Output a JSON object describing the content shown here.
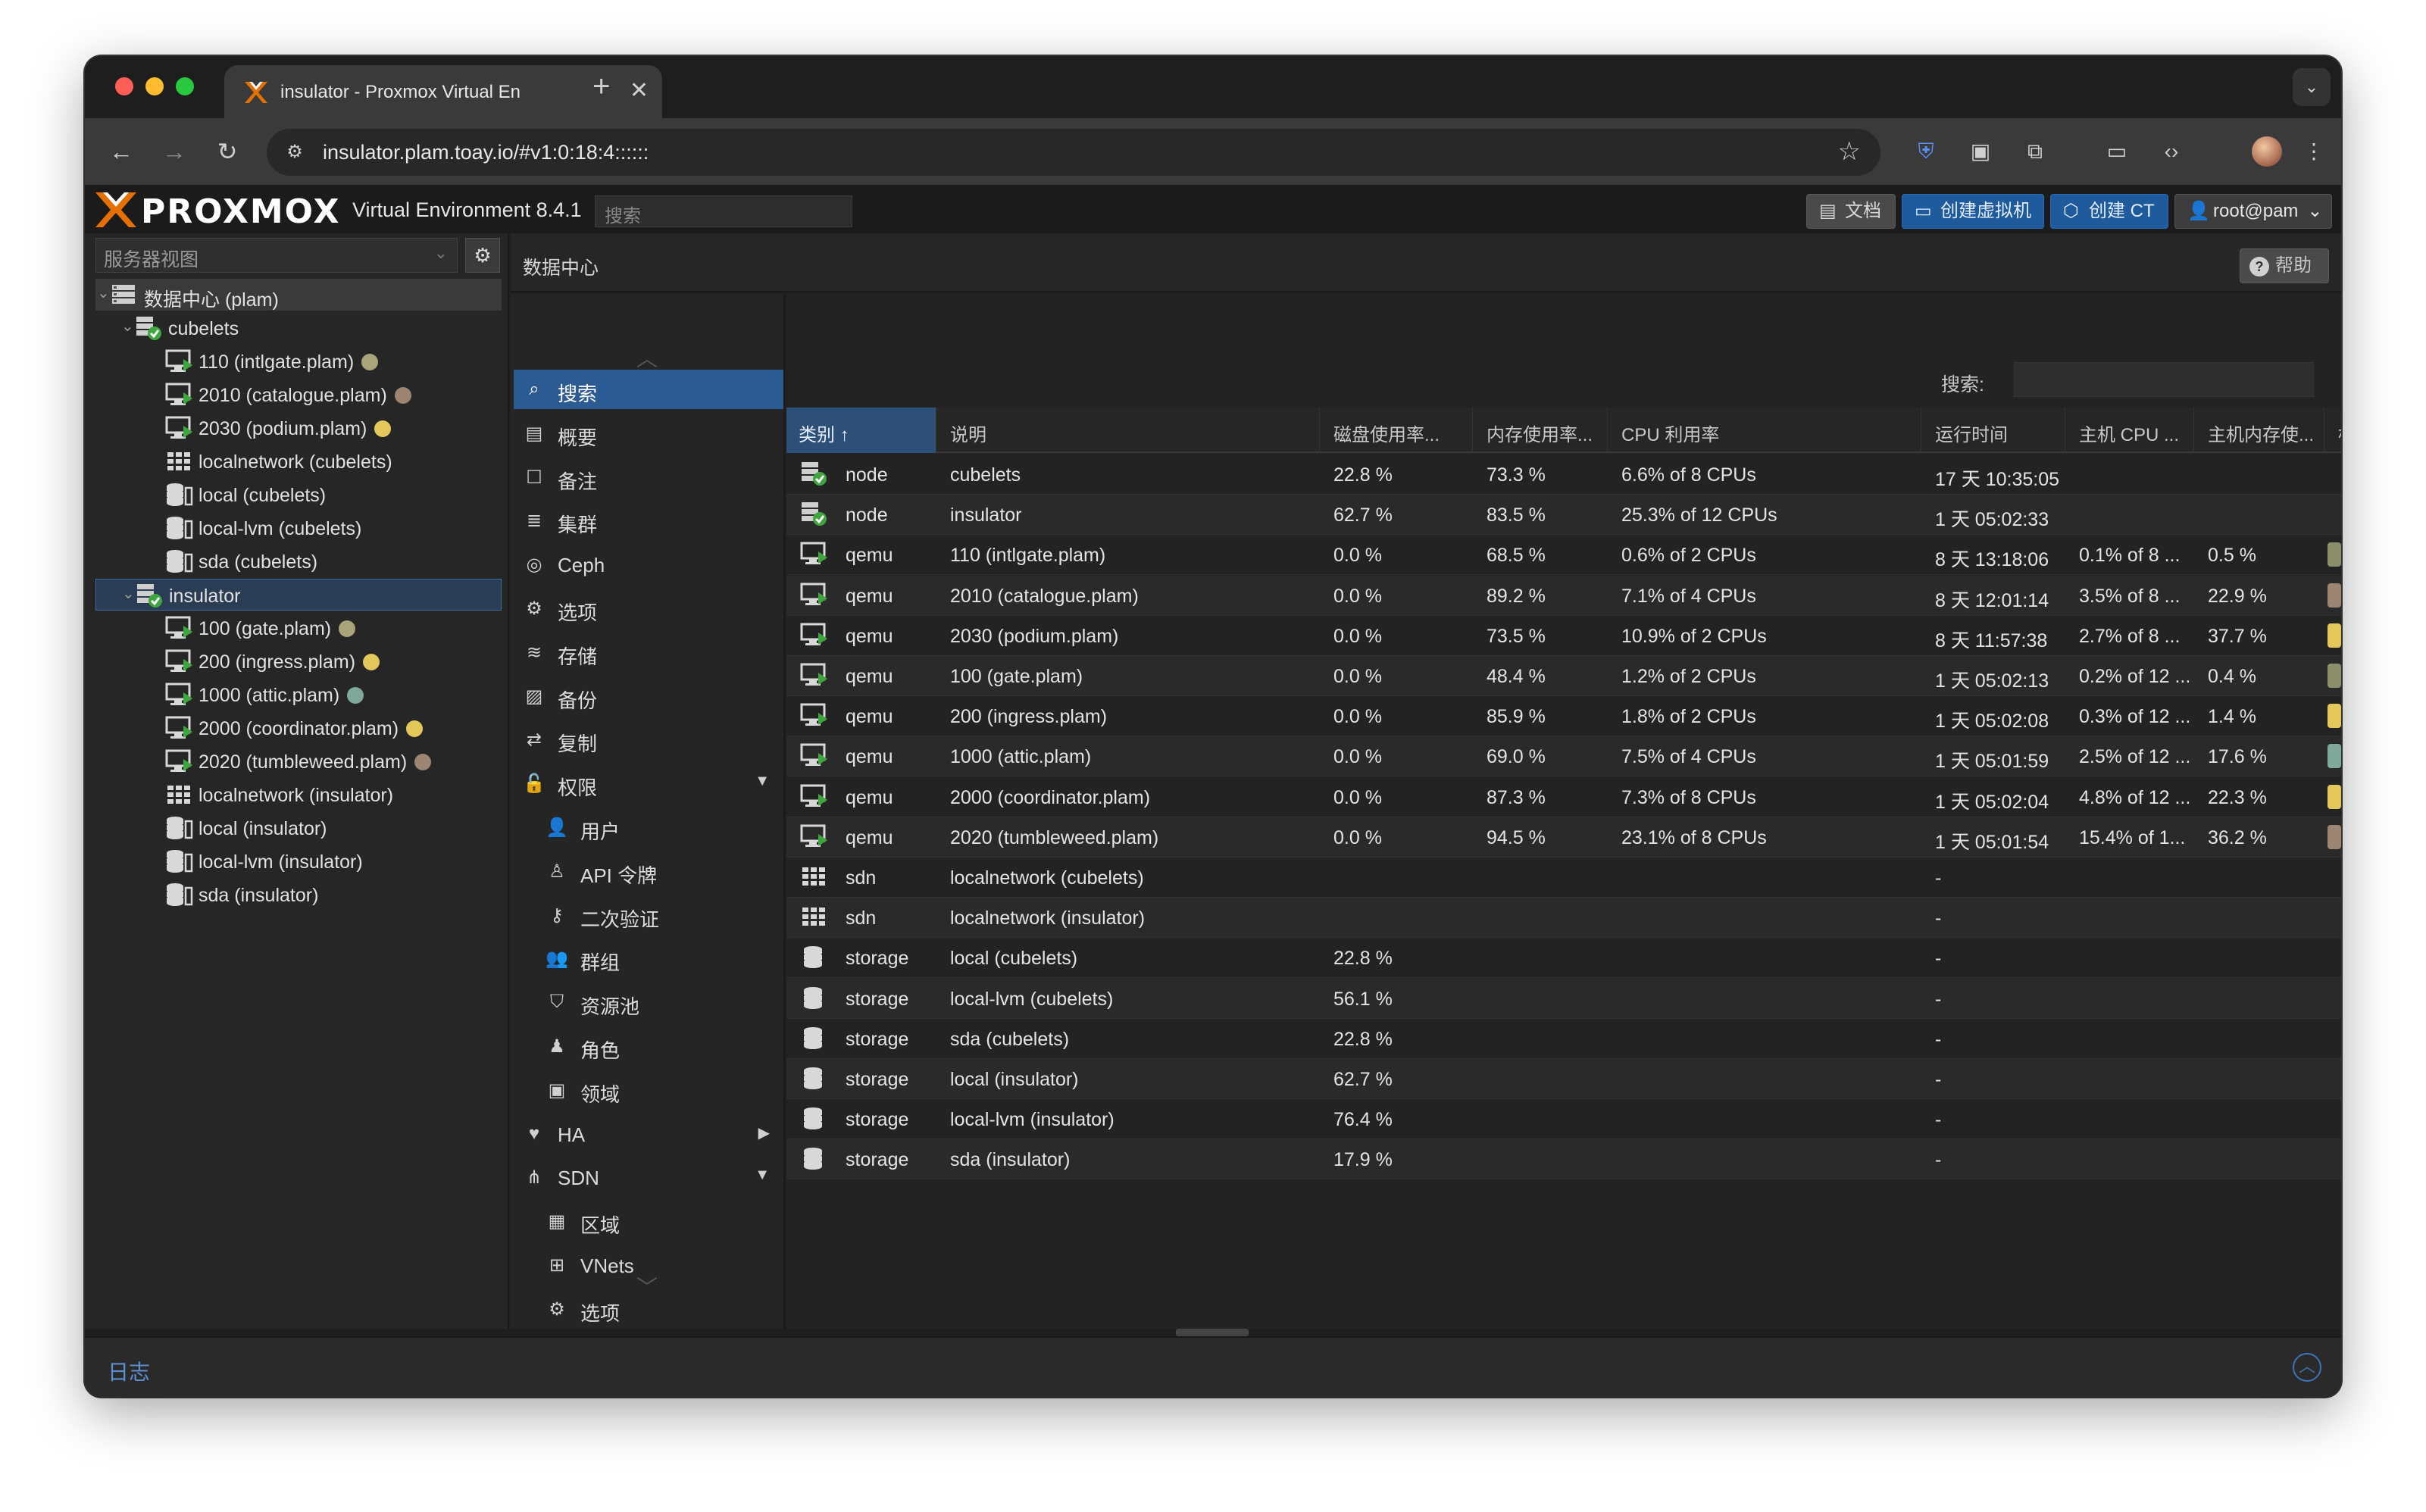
{
  "browser": {
    "tab_title": "insulator - Proxmox Virtual En",
    "url": "insulator.plam.toay.io/#v1:0:18:4::::::"
  },
  "header": {
    "logo": "PROXMOX",
    "version": "Virtual Environment 8.4.1",
    "search_placeholder": "搜索",
    "btn_docs": "文档",
    "btn_create_vm": "创建虚拟机",
    "btn_create_ct": "创建 CT",
    "btn_user": "root@pam"
  },
  "left": {
    "view_select": "服务器视图",
    "tree": [
      {
        "label": "数据中心 (plam)",
        "icon": "datacenter-icon",
        "level": 0
      },
      {
        "label": "cubelets",
        "icon": "node-icon",
        "level": 1
      },
      {
        "label": "110 (intlgate.plam)",
        "icon": "vm-icon",
        "level": 2,
        "dot": "#a9a47a"
      },
      {
        "label": "2010 (catalogue.plam)",
        "icon": "vm-icon",
        "level": 2,
        "dot": "#9c8573"
      },
      {
        "label": "2030 (podium.plam)",
        "icon": "vm-icon",
        "level": 2,
        "dot": "#e4c75a"
      },
      {
        "label": "localnetwork (cubelets)",
        "icon": "grid-icon",
        "level": 2
      },
      {
        "label": "local (cubelets)",
        "icon": "storage-icon",
        "level": 2
      },
      {
        "label": "local-lvm (cubelets)",
        "icon": "storage-icon",
        "level": 2
      },
      {
        "label": "sda (cubelets)",
        "icon": "storage-icon",
        "level": 2
      },
      {
        "label": "insulator",
        "icon": "node-icon",
        "level": 1
      },
      {
        "label": "100 (gate.plam)",
        "icon": "vm-icon",
        "level": 2,
        "dot": "#a9a47a"
      },
      {
        "label": "200 (ingress.plam)",
        "icon": "vm-icon",
        "level": 2,
        "dot": "#e4c75a"
      },
      {
        "label": "1000 (attic.plam)",
        "icon": "vm-icon",
        "level": 2,
        "dot": "#7fa89a"
      },
      {
        "label": "2000 (coordinator.plam)",
        "icon": "vm-icon",
        "level": 2,
        "dot": "#e4c75a"
      },
      {
        "label": "2020 (tumbleweed.plam)",
        "icon": "vm-icon",
        "level": 2,
        "dot": "#9c8573"
      },
      {
        "label": "localnetwork (insulator)",
        "icon": "grid-icon",
        "level": 2
      },
      {
        "label": "local (insulator)",
        "icon": "storage-icon",
        "level": 2
      },
      {
        "label": "local-lvm (insulator)",
        "icon": "storage-icon",
        "level": 2
      },
      {
        "label": "sda (insulator)",
        "icon": "storage-icon",
        "level": 2
      }
    ]
  },
  "content": {
    "title": "数据中心",
    "help": "帮助"
  },
  "menu": [
    {
      "label": "搜索",
      "icon": "search-icon",
      "active": true,
      "level": 0
    },
    {
      "label": "概要",
      "icon": "book-icon",
      "level": 0
    },
    {
      "label": "备注",
      "icon": "note-icon",
      "level": 0
    },
    {
      "label": "集群",
      "icon": "server-icon",
      "level": 0
    },
    {
      "label": "Ceph",
      "icon": "ceph-icon",
      "level": 0
    },
    {
      "label": "选项",
      "icon": "gear-icon",
      "level": 0
    },
    {
      "label": "存储",
      "icon": "database-icon",
      "level": 0
    },
    {
      "label": "备份",
      "icon": "floppy-icon",
      "level": 0
    },
    {
      "label": "复制",
      "icon": "retweet-icon",
      "level": 0
    },
    {
      "label": "权限",
      "icon": "unlock-icon",
      "level": 0,
      "caret": "▼"
    },
    {
      "label": "用户",
      "icon": "user-icon",
      "level": 1
    },
    {
      "label": "API 令牌",
      "icon": "user-outline-icon",
      "level": 1
    },
    {
      "label": "二次验证",
      "icon": "key-icon",
      "level": 1
    },
    {
      "label": "群组",
      "icon": "users-icon",
      "level": 1
    },
    {
      "label": "资源池",
      "icon": "tags-icon",
      "level": 1
    },
    {
      "label": "角色",
      "icon": "male-icon",
      "level": 1
    },
    {
      "label": "领域",
      "icon": "address-book-icon",
      "level": 1
    },
    {
      "label": "HA",
      "icon": "heartbeat-icon",
      "level": 0,
      "caret": "▶"
    },
    {
      "label": "SDN",
      "icon": "sdn-icon",
      "level": 0,
      "caret": "▼"
    },
    {
      "label": "区域",
      "icon": "grid-icon",
      "level": 1
    },
    {
      "label": "VNets",
      "icon": "sitemap-icon",
      "level": 1
    },
    {
      "label": "选项",
      "icon": "gear-icon",
      "level": 1
    }
  ],
  "grid": {
    "search_label": "搜索:",
    "columns": [
      "类别 ↑",
      "说明",
      "磁盘使用率...",
      "内存使用率...",
      "CPU 利用率",
      "运行时间",
      "主机 CPU ...",
      "主机内存使...",
      "标"
    ],
    "rows": [
      {
        "type": "node",
        "desc": "cubelets",
        "disk": "22.8 %",
        "mem": "73.3 %",
        "cpu": "6.6% of 8 CPUs",
        "uptime": "17 天 10:35:05",
        "hcpu": "",
        "hmem": "",
        "tag": ""
      },
      {
        "type": "node",
        "desc": "insulator",
        "disk": "62.7 %",
        "mem": "83.5 %",
        "cpu": "25.3% of 12 CPUs",
        "uptime": "1 天 05:02:33",
        "hcpu": "",
        "hmem": "",
        "tag": ""
      },
      {
        "type": "qemu",
        "desc": "110 (intlgate.plam)",
        "disk": "0.0 %",
        "mem": "68.5 %",
        "cpu": "0.6% of 2 CPUs",
        "uptime": "8 天 13:18:06",
        "hcpu": "0.1% of 8 ...",
        "hmem": "0.5 %",
        "tag": "#8a8f6a"
      },
      {
        "type": "qemu",
        "desc": "2010 (catalogue.plam)",
        "disk": "0.0 %",
        "mem": "89.2 %",
        "cpu": "7.1% of 4 CPUs",
        "uptime": "8 天 12:01:14",
        "hcpu": "3.5% of 8 ...",
        "hmem": "22.9 %",
        "tag": "#9c8573"
      },
      {
        "type": "qemu",
        "desc": "2030 (podium.plam)",
        "disk": "0.0 %",
        "mem": "73.5 %",
        "cpu": "10.9% of 2 CPUs",
        "uptime": "8 天 11:57:38",
        "hcpu": "2.7% of 8 ...",
        "hmem": "37.7 %",
        "tag": "#e4c75a"
      },
      {
        "type": "qemu",
        "desc": "100 (gate.plam)",
        "disk": "0.0 %",
        "mem": "48.4 %",
        "cpu": "1.2% of 2 CPUs",
        "uptime": "1 天 05:02:13",
        "hcpu": "0.2% of 12 ...",
        "hmem": "0.4 %",
        "tag": "#8a8f6a"
      },
      {
        "type": "qemu",
        "desc": "200 (ingress.plam)",
        "disk": "0.0 %",
        "mem": "85.9 %",
        "cpu": "1.8% of 2 CPUs",
        "uptime": "1 天 05:02:08",
        "hcpu": "0.3% of 12 ...",
        "hmem": "1.4 %",
        "tag": "#e4c75a"
      },
      {
        "type": "qemu",
        "desc": "1000 (attic.plam)",
        "disk": "0.0 %",
        "mem": "69.0 %",
        "cpu": "7.5% of 4 CPUs",
        "uptime": "1 天 05:01:59",
        "hcpu": "2.5% of 12 ...",
        "hmem": "17.6 %",
        "tag": "#7fa89a"
      },
      {
        "type": "qemu",
        "desc": "2000 (coordinator.plam)",
        "disk": "0.0 %",
        "mem": "87.3 %",
        "cpu": "7.3% of 8 CPUs",
        "uptime": "1 天 05:02:04",
        "hcpu": "4.8% of 12 ...",
        "hmem": "22.3 %",
        "tag": "#e4c75a"
      },
      {
        "type": "qemu",
        "desc": "2020 (tumbleweed.plam)",
        "disk": "0.0 %",
        "mem": "94.5 %",
        "cpu": "23.1% of 8 CPUs",
        "uptime": "1 天 05:01:54",
        "hcpu": "15.4% of 1...",
        "hmem": "36.2 %",
        "tag": "#9c8573"
      },
      {
        "type": "sdn",
        "desc": "localnetwork (cubelets)",
        "disk": "",
        "mem": "",
        "cpu": "",
        "uptime": "-",
        "hcpu": "",
        "hmem": "",
        "tag": ""
      },
      {
        "type": "sdn",
        "desc": "localnetwork (insulator)",
        "disk": "",
        "mem": "",
        "cpu": "",
        "uptime": "-",
        "hcpu": "",
        "hmem": "",
        "tag": ""
      },
      {
        "type": "storage",
        "desc": "local (cubelets)",
        "disk": "22.8 %",
        "mem": "",
        "cpu": "",
        "uptime": "-",
        "hcpu": "",
        "hmem": "",
        "tag": ""
      },
      {
        "type": "storage",
        "desc": "local-lvm (cubelets)",
        "disk": "56.1 %",
        "mem": "",
        "cpu": "",
        "uptime": "-",
        "hcpu": "",
        "hmem": "",
        "tag": ""
      },
      {
        "type": "storage",
        "desc": "sda (cubelets)",
        "disk": "22.8 %",
        "mem": "",
        "cpu": "",
        "uptime": "-",
        "hcpu": "",
        "hmem": "",
        "tag": ""
      },
      {
        "type": "storage",
        "desc": "local (insulator)",
        "disk": "62.7 %",
        "mem": "",
        "cpu": "",
        "uptime": "-",
        "hcpu": "",
        "hmem": "",
        "tag": ""
      },
      {
        "type": "storage",
        "desc": "local-lvm (insulator)",
        "disk": "76.4 %",
        "mem": "",
        "cpu": "",
        "uptime": "-",
        "hcpu": "",
        "hmem": "",
        "tag": ""
      },
      {
        "type": "storage",
        "desc": "sda (insulator)",
        "disk": "17.9 %",
        "mem": "",
        "cpu": "",
        "uptime": "-",
        "hcpu": "",
        "hmem": "",
        "tag": ""
      }
    ]
  },
  "log": {
    "title": "日志"
  }
}
